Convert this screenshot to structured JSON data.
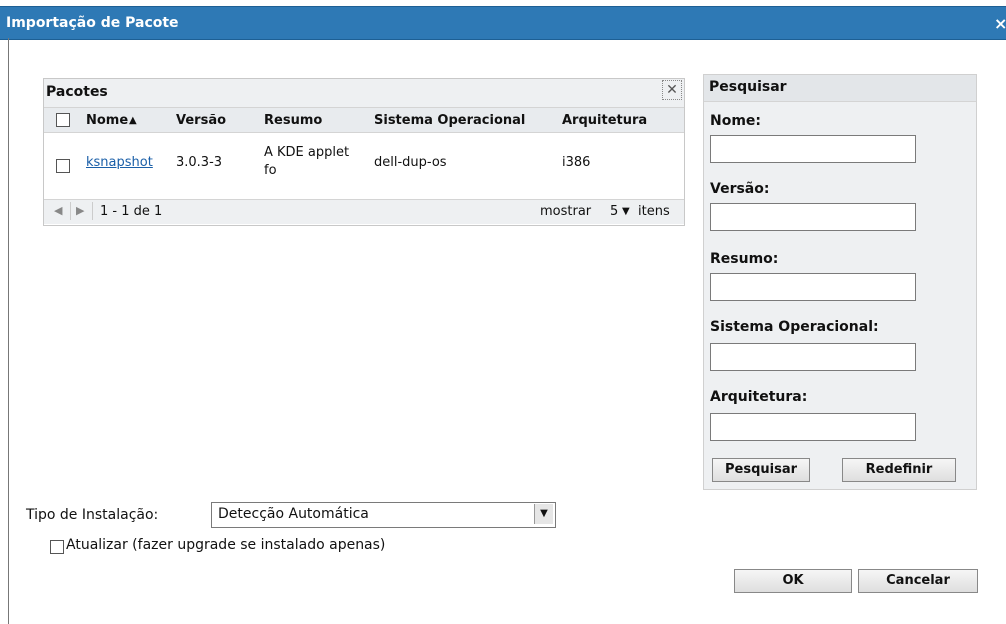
{
  "window": {
    "title": "Importação de Pacote",
    "close_glyph": "×"
  },
  "packages_panel": {
    "title": "Pacotes",
    "close_glyph": "✕",
    "columns": [
      "Nome",
      "Versão",
      "Resumo",
      "Sistema Operacional",
      "Arquitetura"
    ],
    "sort_indicator": "▲",
    "rows": [
      {
        "name": "ksnapshot",
        "version": "3.0.3-3",
        "summary_line1": "A KDE applet",
        "summary_line2": "fo",
        "os": "dell-dup-os",
        "arch": "i386"
      }
    ],
    "pager": {
      "range": "1 - 1 de 1",
      "show_label": "mostrar",
      "page_size": "5",
      "items_label": "itens"
    }
  },
  "search": {
    "title": "Pesquisar",
    "fields": {
      "name": {
        "label": "Nome:",
        "value": ""
      },
      "version": {
        "label": "Versão:",
        "value": ""
      },
      "summary": {
        "label": "Resumo:",
        "value": ""
      },
      "os": {
        "label": "Sistema Operacional:",
        "value": ""
      },
      "arch": {
        "label": "Arquitetura:",
        "value": ""
      }
    },
    "search_button": "Pesquisar",
    "reset_button": "Redefinir"
  },
  "install": {
    "label": "Tipo de Instalação:",
    "selected": "Detecção Automática"
  },
  "upgrade_checkbox": {
    "label": "Atualizar (fazer upgrade se instalado apenas)",
    "checked": false
  },
  "buttons": {
    "ok": "OK",
    "cancel": "Cancelar"
  }
}
